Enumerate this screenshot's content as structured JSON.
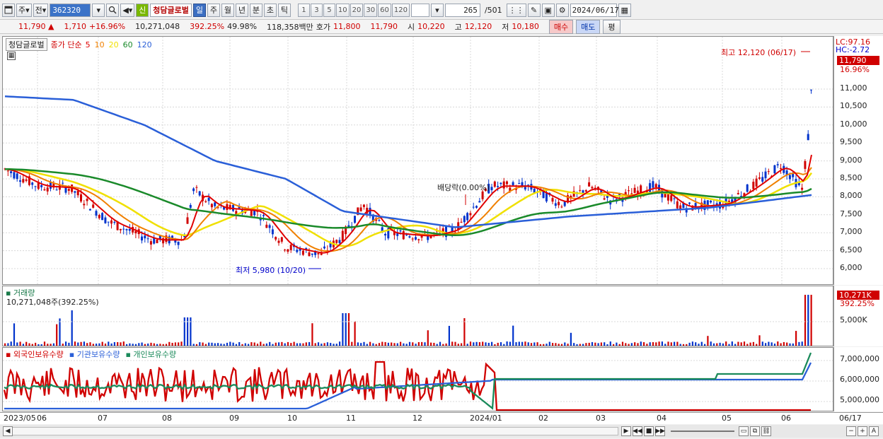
{
  "toolbar": {
    "market": "주",
    "range": "전",
    "code": "362320",
    "new_badge": "신",
    "stock_name": "청담글로벌",
    "periods": [
      "일",
      "주",
      "월",
      "년",
      "분",
      "초",
      "틱"
    ],
    "active_period": "일",
    "minutes": [
      "1",
      "3",
      "5",
      "10",
      "20",
      "30",
      "60",
      "120"
    ],
    "count": "265",
    "total": "/501",
    "date": "2024/06/17"
  },
  "quote": {
    "price": "11,790",
    "arrow": "▲",
    "change": "1,710",
    "change_pct": "+16.96%",
    "volume": "10,271,048",
    "volume_ratio": "392.25%",
    "turnover": "49.98%",
    "amount": "118,358백만",
    "ask_label": "호가",
    "ask": "11,800",
    "bid": "11,790",
    "open_label": "시",
    "open": "10,220",
    "high_label": "고",
    "high": "12,120",
    "low_label": "저",
    "low": "10,180",
    "buy": "매수",
    "sell": "매도",
    "eval": "평"
  },
  "price_panel": {
    "title": "청담글로벌",
    "legend_label": "종가 단순",
    "ma": [
      {
        "period": "5",
        "color": "#e00000"
      },
      {
        "period": "10",
        "color": "#f08000"
      },
      {
        "period": "20",
        "color": "#f0e000"
      },
      {
        "period": "60",
        "color": "#1a8a2a"
      },
      {
        "period": "120",
        "color": "#2a5fd8"
      }
    ],
    "lc": "LC:97.16",
    "hc": "HC:-2.72",
    "last_price": "11,790",
    "last_pct": "16.96%",
    "yticks": [
      "11,000",
      "10,500",
      "10,000",
      "9,500",
      "9,000",
      "8,500",
      "8,000",
      "7,500",
      "7,000",
      "6,500",
      "6,000"
    ],
    "high_annotation": "최고 12,120 (06/17)",
    "low_annotation": "최저 5,980 (10/20)",
    "dividend_annotation": "배당락(0.00%)"
  },
  "volume_panel": {
    "title": "거래량",
    "value": "10,271,048주(392.25%)",
    "last": "10,271K",
    "last_pct": "392.25%",
    "ytick": "5,000K"
  },
  "holding_panel": {
    "series": [
      {
        "name": "외국인보유수량",
        "color": "#d00000"
      },
      {
        "name": "기관보유수량",
        "color": "#2a5fd8"
      },
      {
        "name": "개인보유수량",
        "color": "#1a8a5a"
      }
    ],
    "yticks": [
      "7,000,000",
      "6,000,000",
      "5,000,000"
    ]
  },
  "xaxis": {
    "labels": [
      "2023/05",
      "06",
      "07",
      "08",
      "09",
      "10",
      "11",
      "12",
      "2024/01",
      "02",
      "03",
      "04",
      "05",
      "06",
      "06/17"
    ]
  },
  "colors": {
    "up": "#d00000",
    "down": "#0033cc",
    "active": "#3c6fc2"
  }
}
